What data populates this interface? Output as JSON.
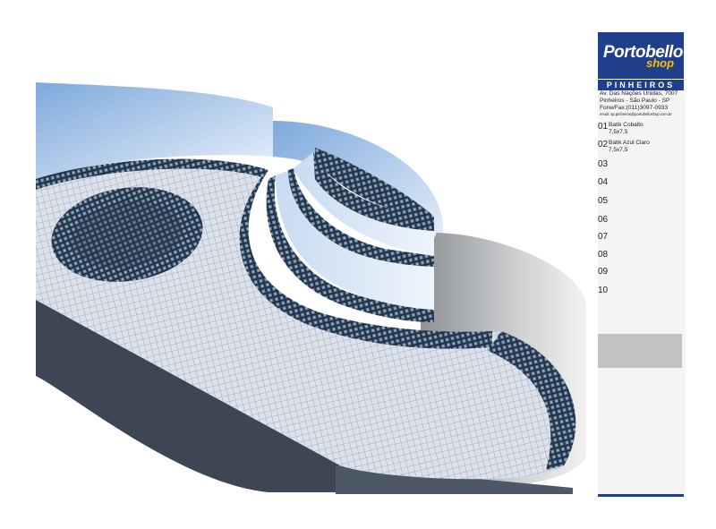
{
  "scene": {
    "colors": {
      "floor": "#d8dde4",
      "tile_dark": "#243446",
      "wall_blue": "#a9c8ec",
      "wall_grey": "#9a9ea3",
      "base": "#3c4654"
    }
  },
  "brand": {
    "name": "Portobello",
    "sub": "shop",
    "store": "PINHEIROS",
    "colors": {
      "primary": "#1f3f8c",
      "accent": "#f2c200"
    }
  },
  "address": {
    "line1": "Av. Das Nações Unidas, 7007",
    "line2": "Pinheiros - São Paulo - SP",
    "line3": "Fone/Fax:(011)3097-0933",
    "email": "email: sp.pinheiros@portobelloshop.com.br"
  },
  "tiles": [
    {
      "num": "01",
      "name": "Batik Cobalto",
      "size": "7,5x7,5"
    },
    {
      "num": "02",
      "name": "Batik Azul Claro",
      "size": "7,5x7,5"
    },
    {
      "num": "03",
      "name": "",
      "size": ""
    },
    {
      "num": "04",
      "name": "",
      "size": ""
    },
    {
      "num": "05",
      "name": "",
      "size": ""
    },
    {
      "num": "06",
      "name": "",
      "size": ""
    },
    {
      "num": "07",
      "name": "",
      "size": ""
    },
    {
      "num": "08",
      "name": "",
      "size": ""
    },
    {
      "num": "09",
      "name": "",
      "size": ""
    },
    {
      "num": "10",
      "name": "",
      "size": ""
    }
  ]
}
